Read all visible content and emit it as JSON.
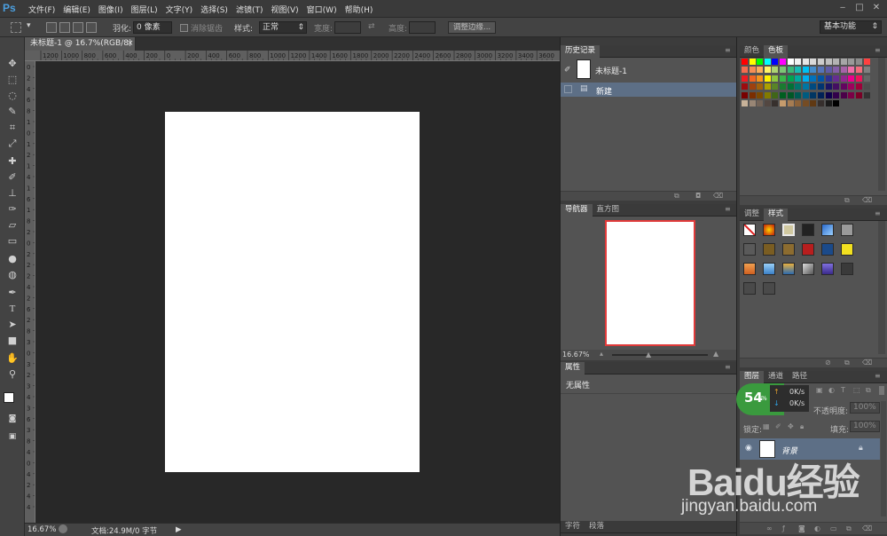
{
  "app": {
    "logo": "Ps"
  },
  "menu": [
    "文件(F)",
    "编辑(E)",
    "图像(I)",
    "图层(L)",
    "文字(Y)",
    "选择(S)",
    "滤镜(T)",
    "视图(V)",
    "窗口(W)",
    "帮助(H)"
  ],
  "window_controls": [
    "‒",
    "□",
    "✕"
  ],
  "options": {
    "feather_label": "羽化:",
    "feather_value": "0 像素",
    "antialias_label": "消除锯齿",
    "style_label": "样式:",
    "style_value": "正常",
    "width_label": "宽度:",
    "height_label": "高度:",
    "refine_edge": "调整边缘...",
    "workspace": "基本功能"
  },
  "document": {
    "tab_title": "未标题-1 @ 16.7%(RGB/8)",
    "close": "×",
    "zoom": "16.67%",
    "doc_info": "文档:24.9M/0 字节"
  },
  "ruler": {
    "h_labels": [
      "1200",
      "1000",
      "800",
      "600",
      "400",
      "200",
      "0",
      "200",
      "400",
      "600",
      "800",
      "1000",
      "1200",
      "1400",
      "1600",
      "1800",
      "2000",
      "2200",
      "2400",
      "2600",
      "2800",
      "3000",
      "3200",
      "3400",
      "3600"
    ],
    "v_labels": [
      "0",
      "2",
      "4",
      "6",
      "8",
      "1",
      "0",
      "1",
      "2",
      "1",
      "4",
      "1",
      "6",
      "1",
      "8",
      "2",
      "0",
      "2",
      "2",
      "2",
      "4",
      "2",
      "6",
      "2",
      "8",
      "3",
      "0",
      "3",
      "2",
      "3",
      "4",
      "3",
      "6",
      "3",
      "8",
      "4",
      "0",
      "4",
      "2",
      "4",
      "4"
    ]
  },
  "panels": {
    "history": {
      "tab": "历史记录",
      "snapshot": "未标题-1",
      "step": "新建"
    },
    "navigator": {
      "tabs": [
        "导航器",
        "直方图"
      ],
      "zoom": "16.67%"
    },
    "properties": {
      "tab": "属性",
      "empty": "无属性"
    },
    "character": {
      "tabs": [
        "字符",
        "段落"
      ]
    },
    "color": {
      "tabs": [
        "颜色",
        "色板"
      ]
    },
    "styles": {
      "tabs": [
        "调整",
        "样式"
      ]
    },
    "layers": {
      "tabs": [
        "图层",
        "通道",
        "路径"
      ],
      "opacity_label": "不透明度:",
      "opacity_value": "100%",
      "lock_label": "锁定:",
      "fill_label": "填充:",
      "fill_value": "100%",
      "layer_name": "背景"
    }
  },
  "speed_badge": {
    "percent": "54",
    "unit": "%",
    "up": "0K/s",
    "down": "0K/s"
  },
  "watermark": {
    "brand": "Baidu经验",
    "url": "jingyan.baidu.com"
  },
  "colors": {
    "canvas_bg": "#282828",
    "panel_bg": "#535353",
    "document": "#ffffff",
    "navigator_frame": "#e03a3a"
  }
}
